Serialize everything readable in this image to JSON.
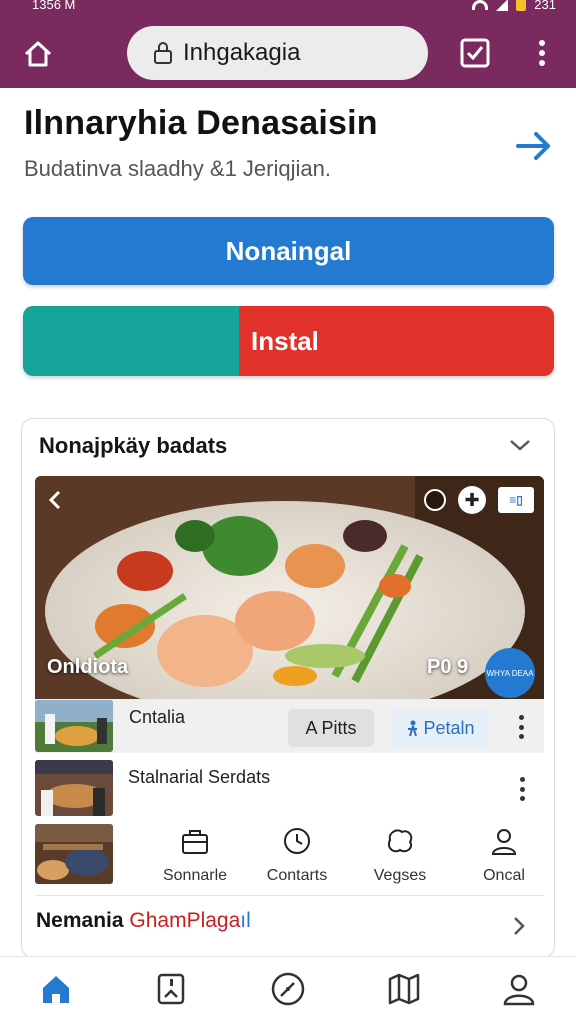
{
  "status_bar": {
    "time": "1356 M",
    "battery_label": "231"
  },
  "app_bar": {
    "url_text": "Inhgakagia"
  },
  "header": {
    "title": "Ilnnaryhia Denasaisin",
    "subtitle": "Budatinva slaadhy &1 Jeriqjian."
  },
  "buttons": {
    "primary_label": "Nonaingal",
    "install_label": "Instal"
  },
  "card": {
    "title": "Nonajpkäy badats",
    "hero": {
      "caption": "Onldiota",
      "count": "P0 9",
      "badge": "WHYA DEAA"
    },
    "row1": {
      "label": "Cntalia",
      "pill_grey": "A Pitts",
      "pill_blue": "Petaln"
    },
    "row2": {
      "label": "Stalnarial Serdats"
    },
    "actions": [
      {
        "label": "Sonnarle",
        "icon": "briefcase-icon"
      },
      {
        "label": "Contarts",
        "icon": "compass-icon"
      },
      {
        "label": "Vegses",
        "icon": "leaf-icon"
      },
      {
        "label": "Oncal",
        "icon": "person-icon"
      }
    ],
    "related": {
      "part1": "Nemania",
      "part2": "GhamPlaga",
      "part3": "ıl"
    }
  },
  "colors": {
    "app_bar": "#7a2a5e",
    "primary": "#2479d1",
    "teal": "#16a39a",
    "red": "#e0322b"
  },
  "bottom_nav": [
    {
      "icon": "home-icon",
      "active": true
    },
    {
      "icon": "bookmark-icon",
      "active": false
    },
    {
      "icon": "explore-icon",
      "active": false
    },
    {
      "icon": "map-icon",
      "active": false
    },
    {
      "icon": "profile-icon",
      "active": false
    }
  ]
}
